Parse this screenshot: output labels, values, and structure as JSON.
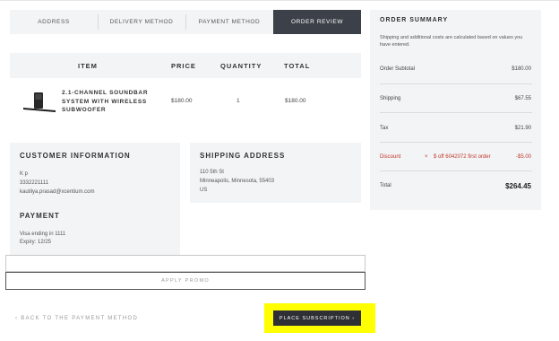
{
  "steps": [
    {
      "label": "ADDRESS"
    },
    {
      "label": "DELIVERY METHOD"
    },
    {
      "label": "PAYMENT METHOD"
    },
    {
      "label": "ORDER REVIEW"
    }
  ],
  "items_table": {
    "headers": {
      "item": "ITEM",
      "price": "PRICE",
      "quantity": "QUANTITY",
      "total": "TOTAL"
    },
    "rows": [
      {
        "name": "2.1-CHANNEL SOUNDBAR SYSTEM WITH WIRELESS SUBWOOFER",
        "price": "$180.00",
        "quantity": "1",
        "total": "$180.00",
        "thumb_icon": "soundbar-product-image"
      }
    ]
  },
  "customer_info": {
    "title": "CUSTOMER INFORMATION",
    "name": "K p",
    "phone": "3332221111",
    "email": "kautilya.prasad@xcentium.com"
  },
  "shipping_address": {
    "title": "SHIPPING ADDRESS",
    "line1": "110 5th St",
    "line2": "Minneapolis, Minnesota, 55403",
    "line3": "US"
  },
  "payment": {
    "title": "PAYMENT",
    "card": "Visa ending in 1111",
    "expiry": "Expiry: 12/25"
  },
  "promo": {
    "placeholder": "",
    "button_label": "APPLY PROMO"
  },
  "actions": {
    "back_label": "‹ BACK TO THE PAYMENT METHOD",
    "place_label": "PLACE SUBSCRIPTION  ›"
  },
  "summary": {
    "title": "ORDER SUMMARY",
    "note": "Shipping and additional costs are calculated based on values you have entered.",
    "rows": [
      {
        "label": "Order Subtotal",
        "value": "$180.00"
      },
      {
        "label": "Shipping",
        "value": "$67.55"
      },
      {
        "label": "Tax",
        "value": "$21.90"
      },
      {
        "label": "Discount",
        "detail": "$ off 6042072 first order",
        "value": "-$5.00"
      },
      {
        "label": "Total",
        "value": "$264.45"
      }
    ]
  },
  "colors": {
    "accent_dark": "#3c4048",
    "discount_red": "#c0392b",
    "highlight_yellow": "#ffff00"
  }
}
